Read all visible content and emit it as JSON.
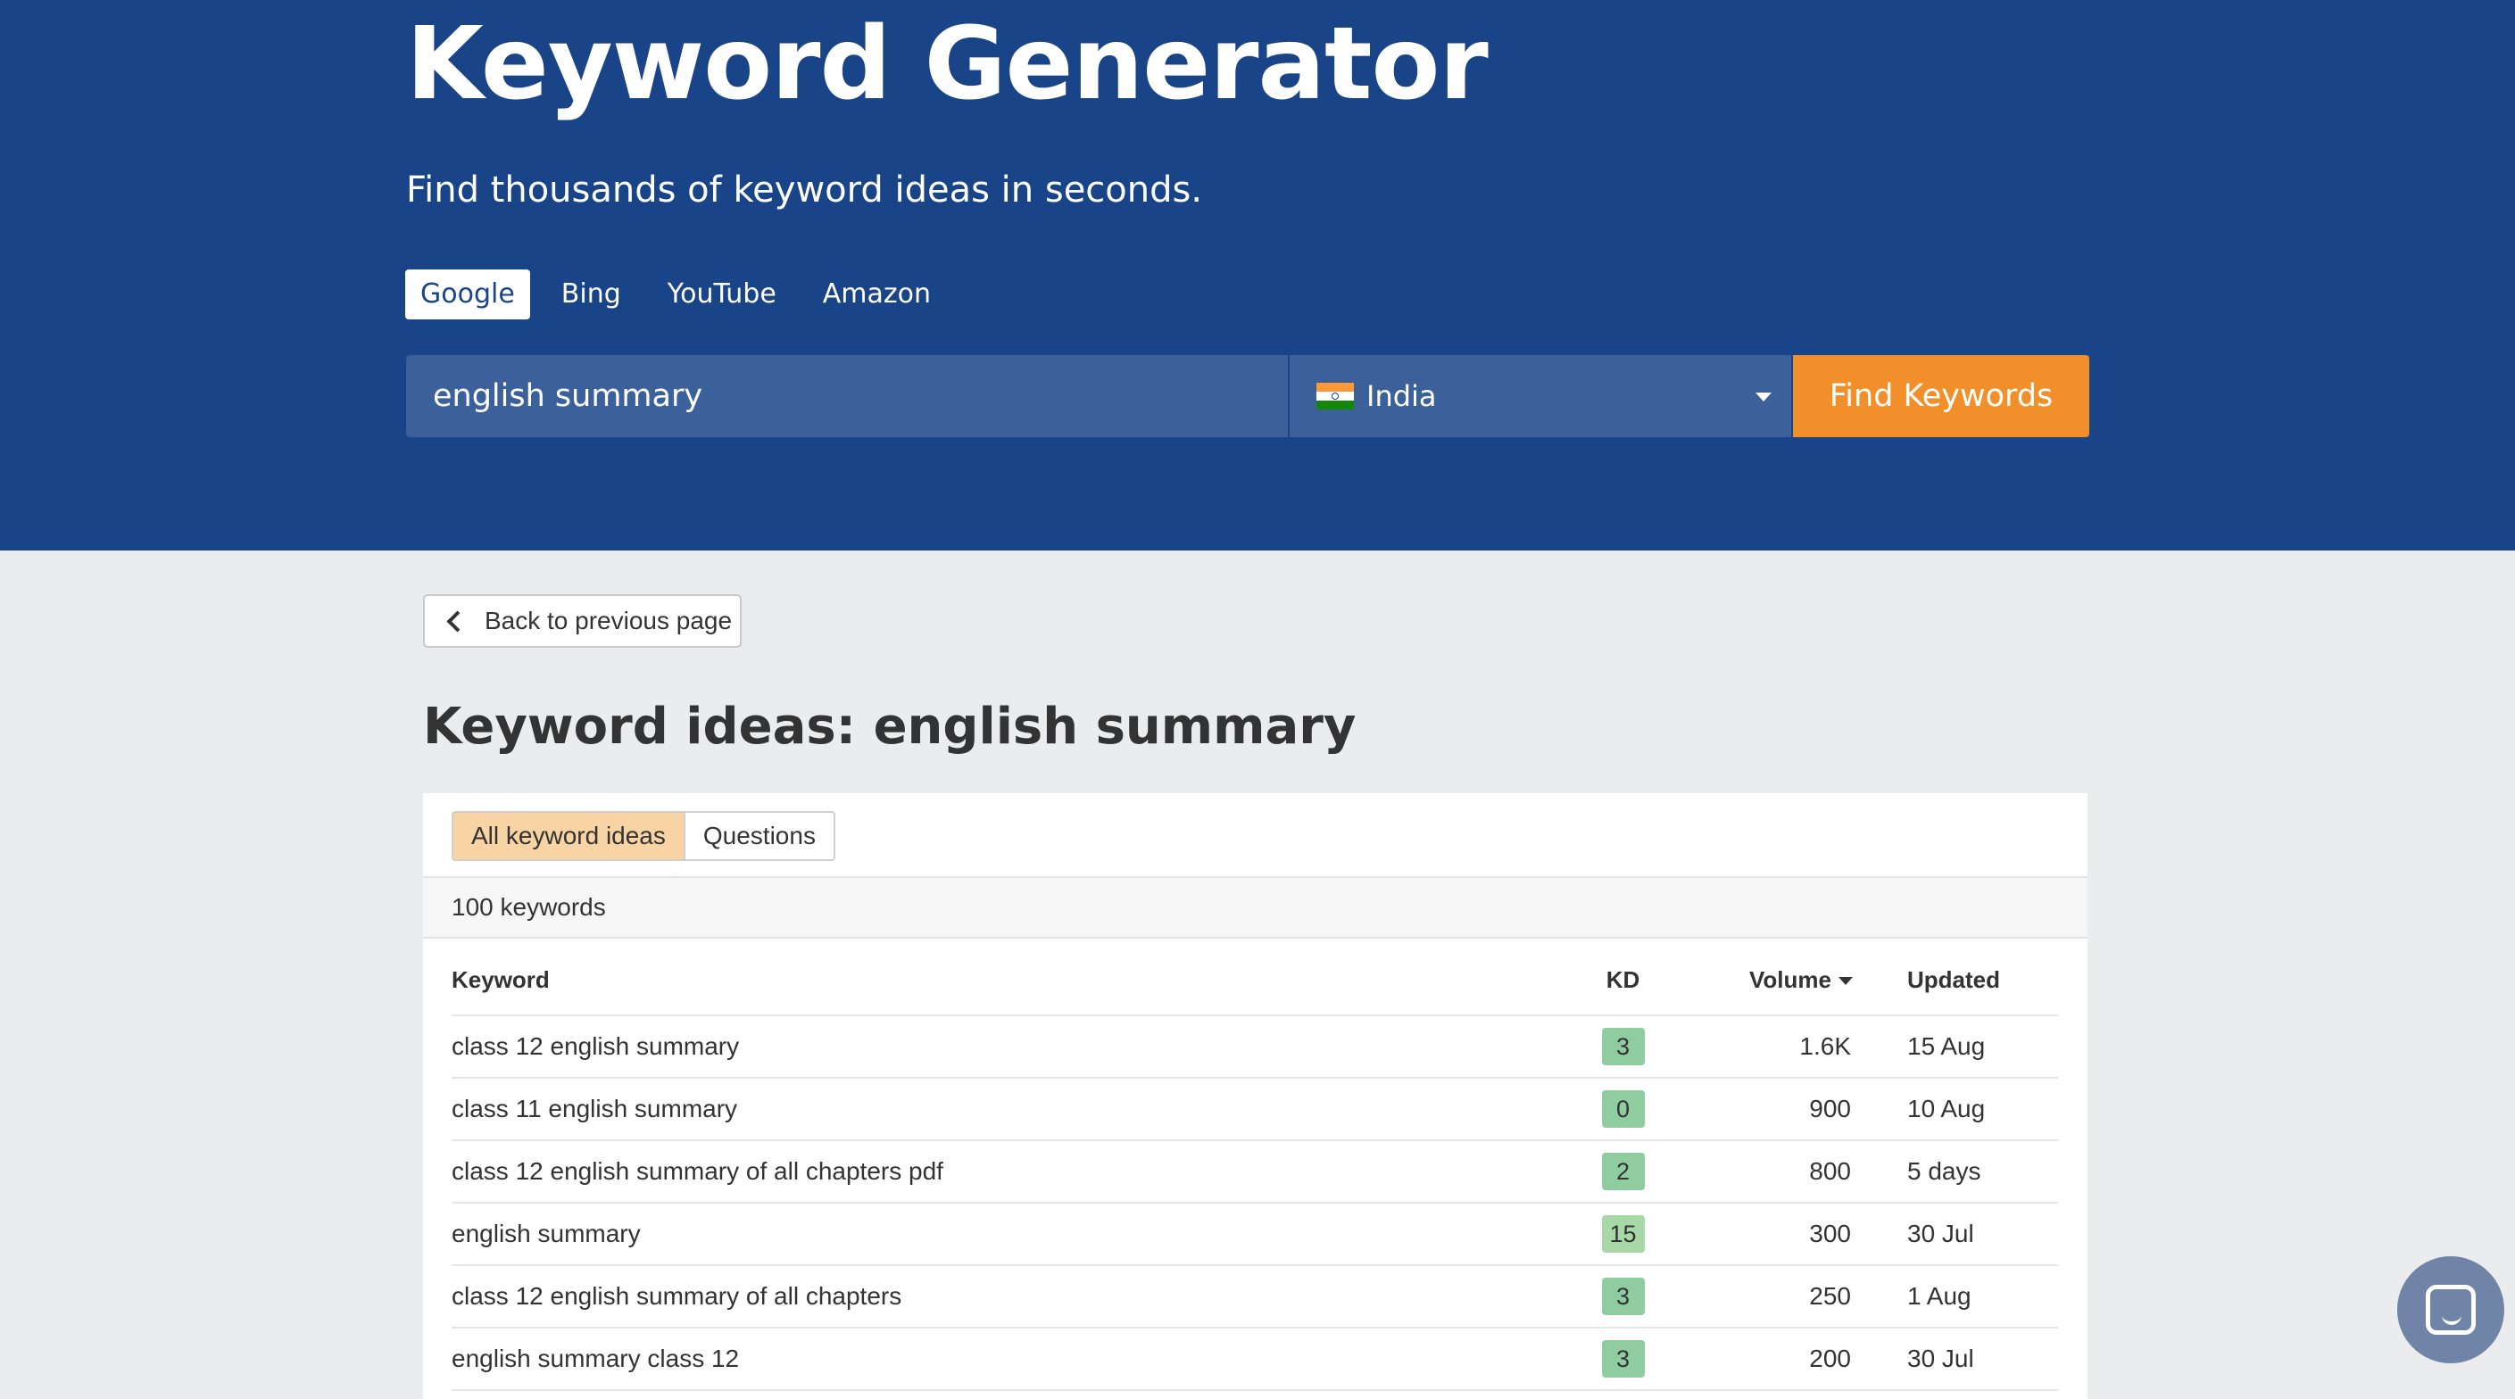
{
  "hero": {
    "title": "Keyword Generator",
    "subtitle": "Find thousands of keyword ideas in seconds."
  },
  "engines": [
    {
      "label": "Google",
      "active": true
    },
    {
      "label": "Bing",
      "active": false
    },
    {
      "label": "YouTube",
      "active": false
    },
    {
      "label": "Amazon",
      "active": false
    }
  ],
  "search": {
    "keyword_value": "english summary",
    "country": "India",
    "country_flag": "india-flag-icon",
    "submit_label": "Find Keywords"
  },
  "back_label": "Back to previous page",
  "results": {
    "title": "Keyword ideas: english summary",
    "tabs": [
      {
        "label": "All keyword ideas",
        "active": true
      },
      {
        "label": "Questions",
        "active": false
      }
    ],
    "count_text": "100 keywords",
    "columns": {
      "keyword": "Keyword",
      "kd": "KD",
      "volume": "Volume",
      "updated": "Updated"
    },
    "rows": [
      {
        "keyword": "class 12 english summary",
        "kd": "3",
        "volume": "1.6K",
        "updated": "15 Aug"
      },
      {
        "keyword": "class 11 english summary",
        "kd": "0",
        "volume": "900",
        "updated": "10 Aug"
      },
      {
        "keyword": "class 12 english summary of all chapters pdf",
        "kd": "2",
        "volume": "800",
        "updated": "5 days"
      },
      {
        "keyword": "english summary",
        "kd": "15",
        "volume": "300",
        "updated": "30 Jul"
      },
      {
        "keyword": "class 12 english summary of all chapters",
        "kd": "3",
        "volume": "250",
        "updated": "1 Aug"
      },
      {
        "keyword": "english summary class 12",
        "kd": "3",
        "volume": "200",
        "updated": "30 Jul"
      }
    ]
  },
  "colors": {
    "hero_bg": "#194488",
    "input_bg": "#3c609a",
    "accent_orange": "#f18f2a",
    "kd_easy": "#8fcca0",
    "kd_low": "#a8d8a8",
    "tab_active_bg": "#f8d3a3"
  },
  "icons": {
    "back": "chevron-left-icon",
    "dropdown": "caret-down-icon",
    "sort": "sort-desc-icon",
    "chat": "chat-icon"
  }
}
